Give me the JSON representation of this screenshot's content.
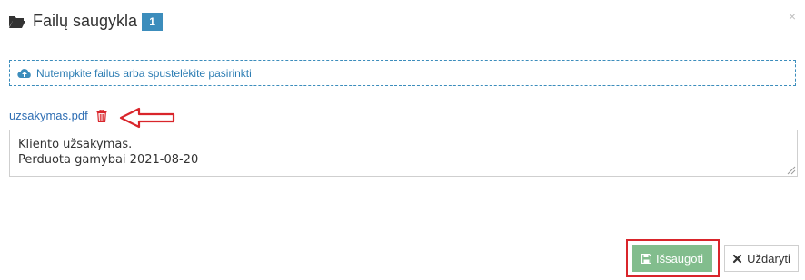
{
  "dialog": {
    "title": "Failų saugykla",
    "file_count": "1",
    "close_symbol": "×",
    "folder_icon": "folder-open-icon"
  },
  "dropzone": {
    "text": "Nutempkite failus arba spustelėkite pasirinkti",
    "icon": "cloud-upload-icon",
    "border_color": "#3c8dbc"
  },
  "file": {
    "name": "uzsakymas.pdf",
    "delete_icon": "trash-icon",
    "note": "Kliento užsakymas.\nPerduota gamybai 2021-08-20"
  },
  "buttons": {
    "save_label": "Išsaugoti",
    "save_icon": "floppy-disk-icon",
    "close_label": "Uždaryti",
    "close_icon": "times-icon"
  },
  "colors": {
    "accent": "#3c8dbc",
    "save_green": "#82bd8d",
    "annotation_red": "#d9252b",
    "link_blue": "#2d6db3"
  }
}
